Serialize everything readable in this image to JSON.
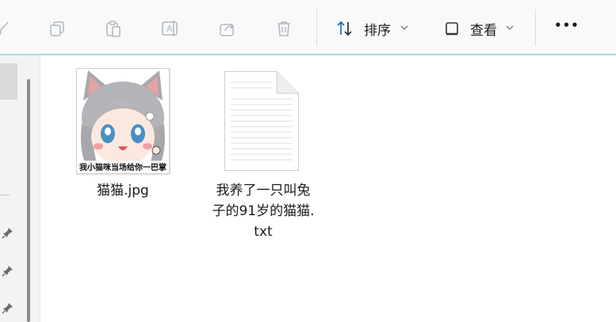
{
  "toolbar": {
    "icons": [
      "cut-icon",
      "copy-icon",
      "paste-icon",
      "rename-icon",
      "share-icon",
      "delete-icon"
    ],
    "sort_label": "排序",
    "view_label": "查看",
    "more_label": "•••"
  },
  "files": [
    {
      "name": "猫猫.jpg",
      "type": "image"
    },
    {
      "name_lines": [
        "我养了一只叫兔",
        "子的91岁的猫猫.",
        "txt"
      ],
      "type": "text-document"
    }
  ],
  "thumbnail_caption": "我小猫咪当场给你一巴掌"
}
